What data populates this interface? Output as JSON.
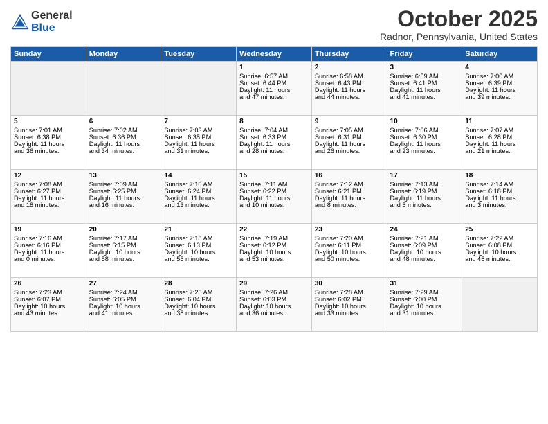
{
  "header": {
    "logo_general": "General",
    "logo_blue": "Blue",
    "title": "October 2025",
    "location": "Radnor, Pennsylvania, United States"
  },
  "days_of_week": [
    "Sunday",
    "Monday",
    "Tuesday",
    "Wednesday",
    "Thursday",
    "Friday",
    "Saturday"
  ],
  "weeks": [
    [
      {
        "day": "",
        "content": ""
      },
      {
        "day": "",
        "content": ""
      },
      {
        "day": "",
        "content": ""
      },
      {
        "day": "1",
        "content": "Sunrise: 6:57 AM\nSunset: 6:44 PM\nDaylight: 11 hours\nand 47 minutes."
      },
      {
        "day": "2",
        "content": "Sunrise: 6:58 AM\nSunset: 6:43 PM\nDaylight: 11 hours\nand 44 minutes."
      },
      {
        "day": "3",
        "content": "Sunrise: 6:59 AM\nSunset: 6:41 PM\nDaylight: 11 hours\nand 41 minutes."
      },
      {
        "day": "4",
        "content": "Sunrise: 7:00 AM\nSunset: 6:39 PM\nDaylight: 11 hours\nand 39 minutes."
      }
    ],
    [
      {
        "day": "5",
        "content": "Sunrise: 7:01 AM\nSunset: 6:38 PM\nDaylight: 11 hours\nand 36 minutes."
      },
      {
        "day": "6",
        "content": "Sunrise: 7:02 AM\nSunset: 6:36 PM\nDaylight: 11 hours\nand 34 minutes."
      },
      {
        "day": "7",
        "content": "Sunrise: 7:03 AM\nSunset: 6:35 PM\nDaylight: 11 hours\nand 31 minutes."
      },
      {
        "day": "8",
        "content": "Sunrise: 7:04 AM\nSunset: 6:33 PM\nDaylight: 11 hours\nand 28 minutes."
      },
      {
        "day": "9",
        "content": "Sunrise: 7:05 AM\nSunset: 6:31 PM\nDaylight: 11 hours\nand 26 minutes."
      },
      {
        "day": "10",
        "content": "Sunrise: 7:06 AM\nSunset: 6:30 PM\nDaylight: 11 hours\nand 23 minutes."
      },
      {
        "day": "11",
        "content": "Sunrise: 7:07 AM\nSunset: 6:28 PM\nDaylight: 11 hours\nand 21 minutes."
      }
    ],
    [
      {
        "day": "12",
        "content": "Sunrise: 7:08 AM\nSunset: 6:27 PM\nDaylight: 11 hours\nand 18 minutes."
      },
      {
        "day": "13",
        "content": "Sunrise: 7:09 AM\nSunset: 6:25 PM\nDaylight: 11 hours\nand 16 minutes."
      },
      {
        "day": "14",
        "content": "Sunrise: 7:10 AM\nSunset: 6:24 PM\nDaylight: 11 hours\nand 13 minutes."
      },
      {
        "day": "15",
        "content": "Sunrise: 7:11 AM\nSunset: 6:22 PM\nDaylight: 11 hours\nand 10 minutes."
      },
      {
        "day": "16",
        "content": "Sunrise: 7:12 AM\nSunset: 6:21 PM\nDaylight: 11 hours\nand 8 minutes."
      },
      {
        "day": "17",
        "content": "Sunrise: 7:13 AM\nSunset: 6:19 PM\nDaylight: 11 hours\nand 5 minutes."
      },
      {
        "day": "18",
        "content": "Sunrise: 7:14 AM\nSunset: 6:18 PM\nDaylight: 11 hours\nand 3 minutes."
      }
    ],
    [
      {
        "day": "19",
        "content": "Sunrise: 7:16 AM\nSunset: 6:16 PM\nDaylight: 11 hours\nand 0 minutes."
      },
      {
        "day": "20",
        "content": "Sunrise: 7:17 AM\nSunset: 6:15 PM\nDaylight: 10 hours\nand 58 minutes."
      },
      {
        "day": "21",
        "content": "Sunrise: 7:18 AM\nSunset: 6:13 PM\nDaylight: 10 hours\nand 55 minutes."
      },
      {
        "day": "22",
        "content": "Sunrise: 7:19 AM\nSunset: 6:12 PM\nDaylight: 10 hours\nand 53 minutes."
      },
      {
        "day": "23",
        "content": "Sunrise: 7:20 AM\nSunset: 6:11 PM\nDaylight: 10 hours\nand 50 minutes."
      },
      {
        "day": "24",
        "content": "Sunrise: 7:21 AM\nSunset: 6:09 PM\nDaylight: 10 hours\nand 48 minutes."
      },
      {
        "day": "25",
        "content": "Sunrise: 7:22 AM\nSunset: 6:08 PM\nDaylight: 10 hours\nand 45 minutes."
      }
    ],
    [
      {
        "day": "26",
        "content": "Sunrise: 7:23 AM\nSunset: 6:07 PM\nDaylight: 10 hours\nand 43 minutes."
      },
      {
        "day": "27",
        "content": "Sunrise: 7:24 AM\nSunset: 6:05 PM\nDaylight: 10 hours\nand 41 minutes."
      },
      {
        "day": "28",
        "content": "Sunrise: 7:25 AM\nSunset: 6:04 PM\nDaylight: 10 hours\nand 38 minutes."
      },
      {
        "day": "29",
        "content": "Sunrise: 7:26 AM\nSunset: 6:03 PM\nDaylight: 10 hours\nand 36 minutes."
      },
      {
        "day": "30",
        "content": "Sunrise: 7:28 AM\nSunset: 6:02 PM\nDaylight: 10 hours\nand 33 minutes."
      },
      {
        "day": "31",
        "content": "Sunrise: 7:29 AM\nSunset: 6:00 PM\nDaylight: 10 hours\nand 31 minutes."
      },
      {
        "day": "",
        "content": ""
      }
    ]
  ]
}
